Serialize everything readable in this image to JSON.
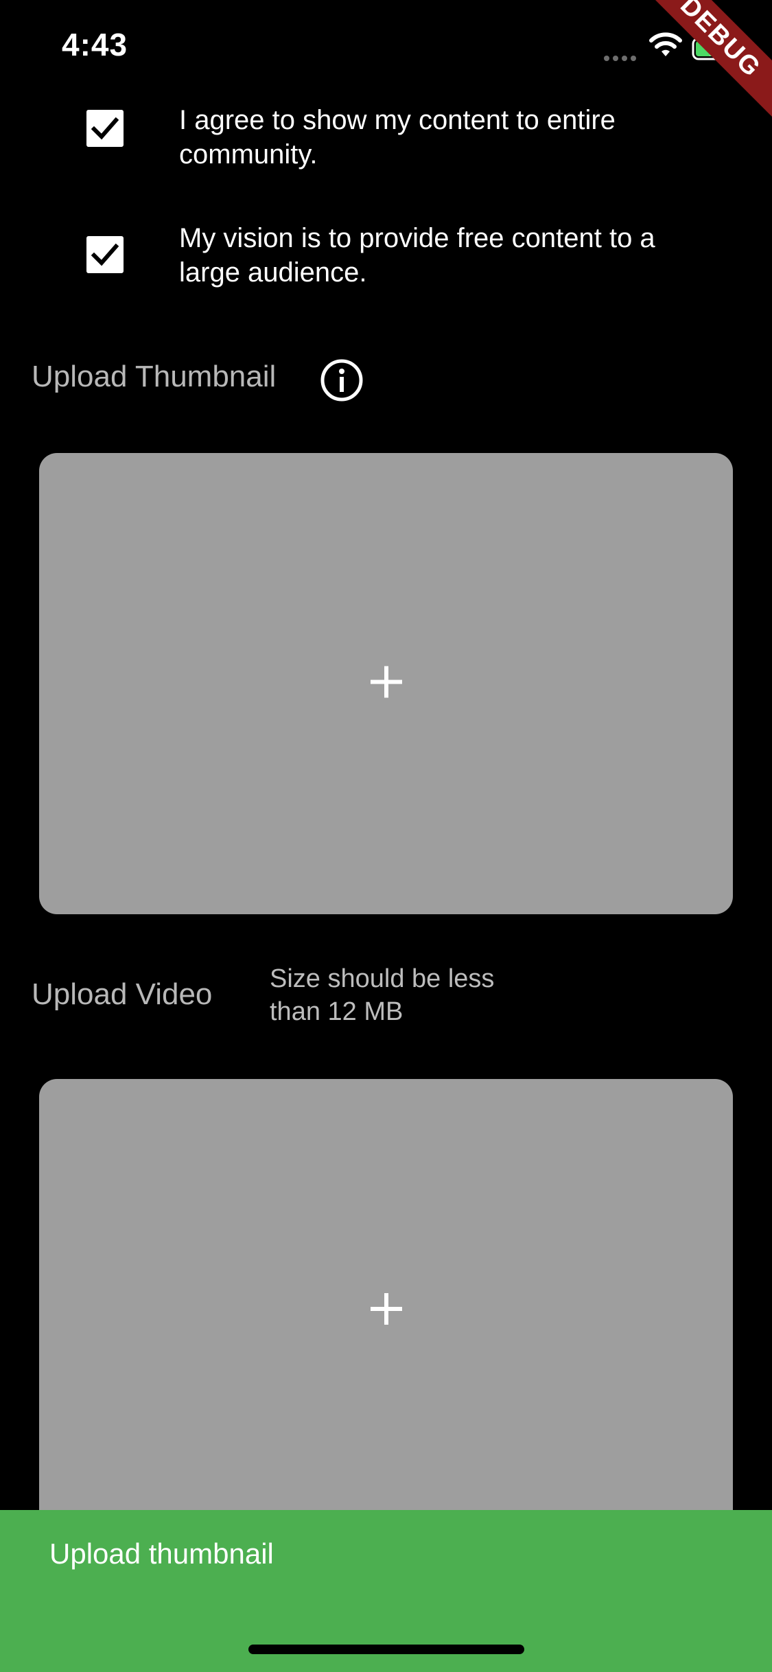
{
  "status_bar": {
    "time": "4:43",
    "debug_label": "DEBUG"
  },
  "agreements": [
    {
      "checked": true,
      "text": "I agree to show my content to entire community."
    },
    {
      "checked": true,
      "text": "My vision is to provide free content to a large audience."
    }
  ],
  "thumbnail": {
    "label": "Upload Thumbnail",
    "info_icon": "info-icon",
    "add_icon": "plus-icon"
  },
  "video": {
    "label": "Upload Video",
    "size_note": "Size should be less than 12 MB",
    "add_icon": "plus-icon"
  },
  "snackbar": {
    "message": "Upload thumbnail"
  },
  "colors": {
    "background": "#000000",
    "upload_box": "#9e9e9e",
    "snackbar": "#4caf50",
    "debug_banner": "#8b1a1a",
    "battery_green": "#4cd964"
  }
}
